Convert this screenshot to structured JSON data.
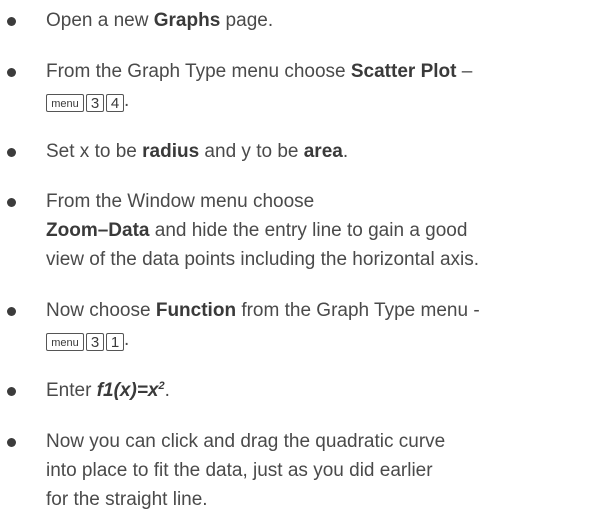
{
  "items": [
    {
      "pre": "Open a new ",
      "bold": "Graphs",
      "post": " page."
    },
    {
      "pre": "From the Graph Type menu choose ",
      "bold": "Scatter Plot",
      "post": " –",
      "keys": [
        "menu",
        "3",
        "4"
      ],
      "keys_suffix": "."
    },
    {
      "pre": "Set x to be ",
      "bold1": "radius",
      "mid": " and y to be ",
      "bold2": "area",
      "post": "."
    },
    {
      "line1": "From the Window menu choose",
      "bold": "Zoom–Data",
      "post": " and hide the entry line to gain a good",
      "line3": "view of the data points including the horizontal axis."
    },
    {
      "pre": "Now choose ",
      "bold": "Function",
      "post": " from the Graph Type menu -",
      "keys": [
        "menu",
        "3",
        "1"
      ],
      "keys_suffix": "."
    },
    {
      "pre": "Enter ",
      "formula": "f1(x)=x",
      "exponent": "2",
      "post": "."
    },
    {
      "line1": "Now you can click and drag the quadratic curve",
      "line2": "into place to fit the data, just as you did earlier",
      "line3": "for the straight line."
    }
  ]
}
